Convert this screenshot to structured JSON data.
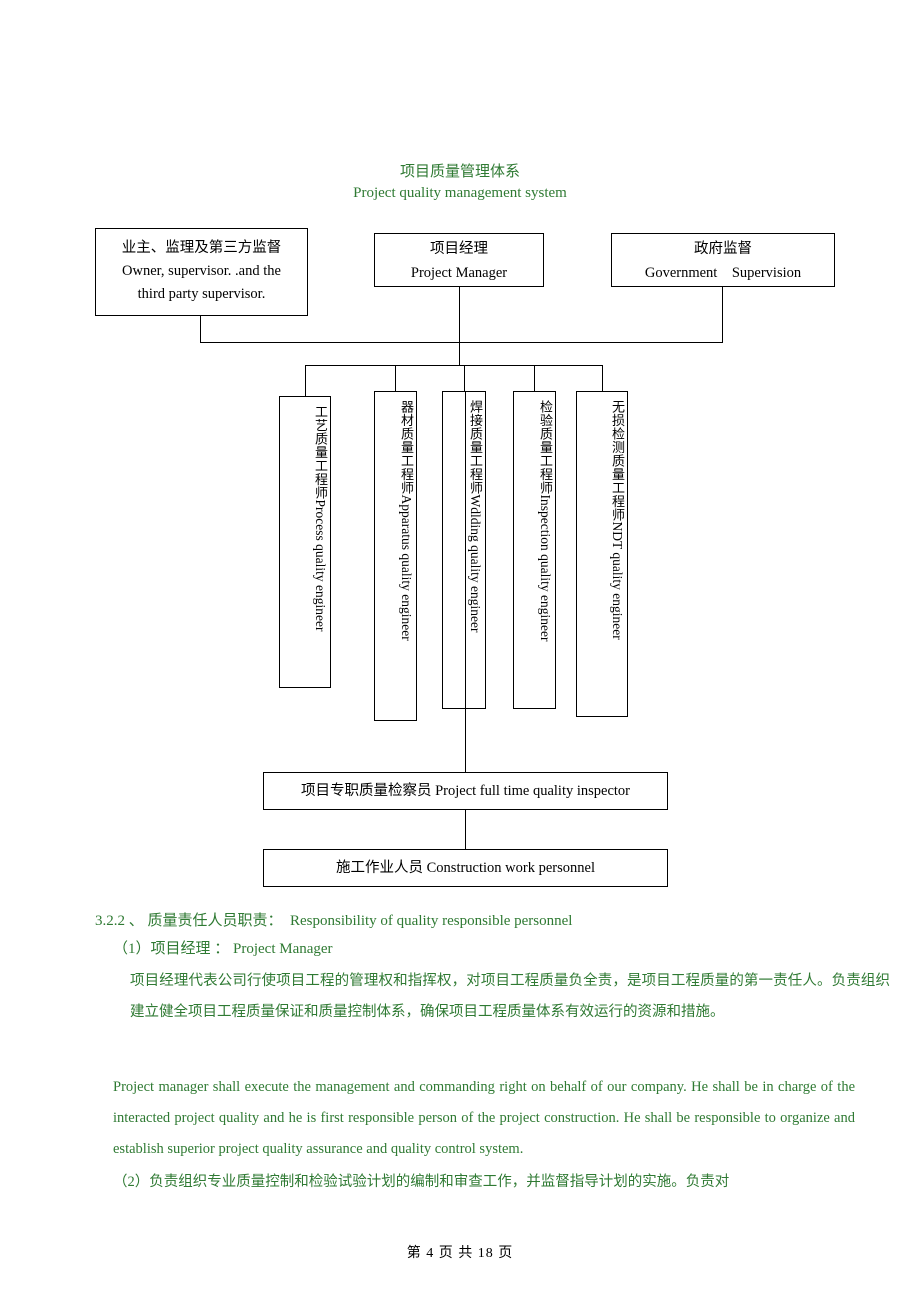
{
  "diagram": {
    "title_cn": "项目质量管理体系",
    "title_en": "Project quality management system",
    "nodes": {
      "owner": {
        "cn": "业主、监理及第三方监督",
        "en_line1": "Owner, supervisor. .and the",
        "en_line2": "third party supervisor."
      },
      "project_manager": {
        "cn": "项目经理",
        "en": "Project Manager"
      },
      "government": {
        "cn": "政府监督",
        "en": "Government　Supervision"
      },
      "process_engineer": {
        "cn": "工艺质量工程师",
        "en": "Process quality engineer"
      },
      "apparatus_engineer": {
        "cn": "器材质量工程师",
        "en": "Apparatus quality engineer"
      },
      "welding_engineer": {
        "cn": "焊接质量工程师",
        "en": "Wdlding quality engineer"
      },
      "inspection_engineer": {
        "cn": "检验质量工程师",
        "en": "Inspection quality engineer"
      },
      "ndt_engineer": {
        "cn": "无损检测质量工程师",
        "en": "NDT quality engineer"
      },
      "inspector": {
        "text": "项目专职质量检察员 Project full time quality inspector"
      },
      "workers": {
        "text": "施工作业人员 Construction work personnel"
      }
    }
  },
  "content": {
    "heading": "3.2.2 、 质量责任人员职责：  Responsibility of quality responsible personnel",
    "subheading": "（1）项目经理 ： Project Manager",
    "paragraph_cn": "项目经理代表公司行使项目工程的管理权和指挥权，对项目工程质量负全责，是项目工程质量的第一责任人。负责组织建立健全项目工程质量保证和质量控制体系，确保项目工程质量体系有效运行的资源和措施。",
    "paragraph_en": "Project manager shall execute the management and commanding right on behalf of our company. He shall be in charge of the interacted project quality and he is first responsible person of the project construction. He shall be responsible to organize and establish superior project quality assurance and quality control system.",
    "paragraph_cn2": "（2）负责组织专业质量控制和检验试验计划的编制和审查工作，并监督指导计划的实施。负责对"
  },
  "footer": {
    "text": "第 4 页 共 18 页"
  },
  "colors": {
    "text_green": "#2f7a33",
    "diagram_black": "#000000"
  }
}
